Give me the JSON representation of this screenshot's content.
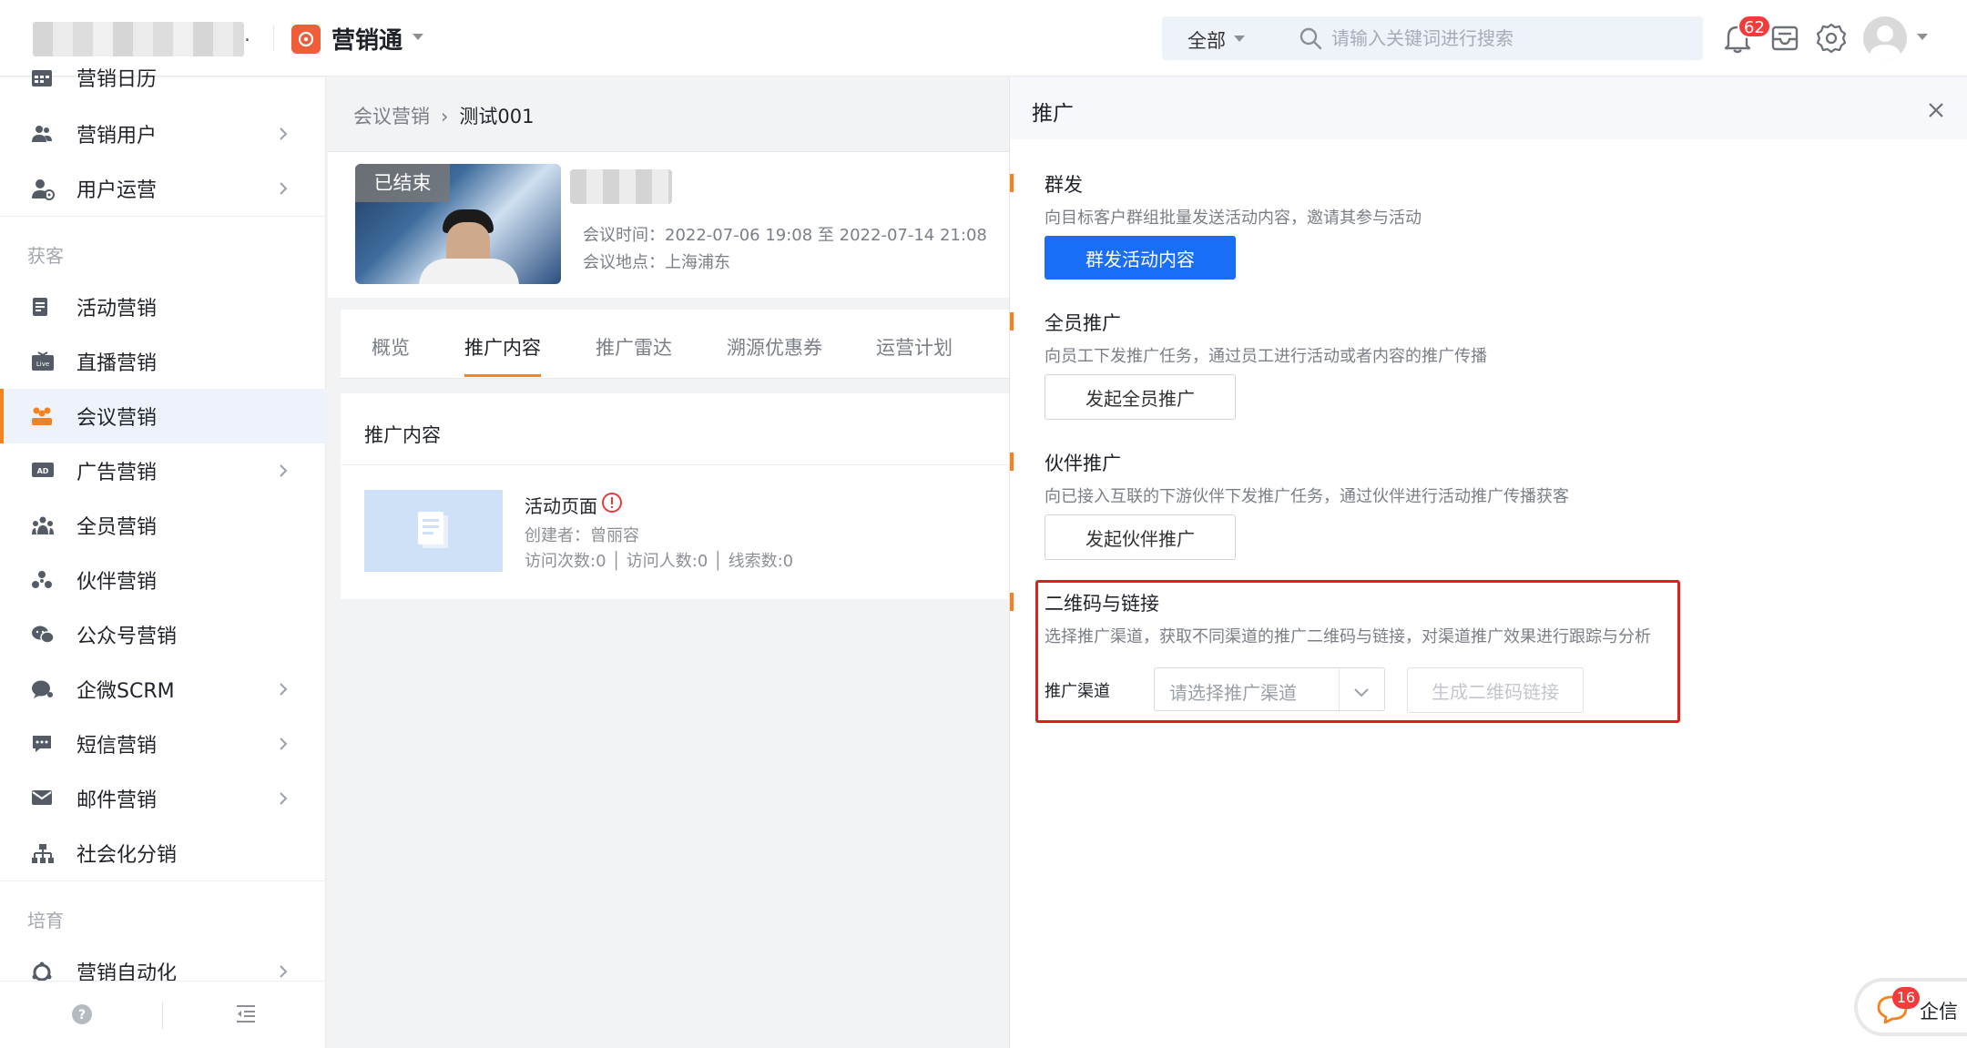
{
  "topbar": {
    "brand_title": "营销通",
    "org_suffix": ".",
    "search": {
      "scope": "全部",
      "placeholder": "请输入关键词进行搜索"
    },
    "notification_count": "62"
  },
  "sidebar": {
    "items_top": [
      {
        "label": "营销日历",
        "icon": "calendar-icon"
      },
      {
        "label": "营销用户",
        "icon": "users-icon",
        "has_children": true
      },
      {
        "label": "用户运营",
        "icon": "user-ops-icon",
        "has_children": true
      }
    ],
    "group_acquire": "获客",
    "items_acquire": [
      {
        "label": "活动营销",
        "icon": "activity-icon"
      },
      {
        "label": "直播营销",
        "icon": "live-icon"
      },
      {
        "label": "会议营销",
        "icon": "meeting-icon",
        "active": true
      },
      {
        "label": "广告营销",
        "icon": "ad-icon",
        "has_children": true
      },
      {
        "label": "全员营销",
        "icon": "team-icon"
      },
      {
        "label": "伙伴营销",
        "icon": "partner-icon"
      },
      {
        "label": "公众号营销",
        "icon": "wechat-icon"
      },
      {
        "label": "企微SCRM",
        "icon": "scrm-icon",
        "has_children": true
      },
      {
        "label": "短信营销",
        "icon": "sms-icon",
        "has_children": true
      },
      {
        "label": "邮件营销",
        "icon": "mail-icon",
        "has_children": true
      },
      {
        "label": "社会化分销",
        "icon": "distribution-icon"
      }
    ],
    "group_nurture": "培育",
    "items_nurture": [
      {
        "label": "营销自动化",
        "icon": "automation-icon",
        "has_children": true
      }
    ]
  },
  "main": {
    "breadcrumb": {
      "parent": "会议营销",
      "current": "测试001"
    },
    "meeting": {
      "status_tag": "已结束",
      "time": "会议时间：2022-07-06 19:08 至 2022-07-14 21:08",
      "location": "会议地点：上海浦东"
    },
    "tabs": [
      "概览",
      "推广内容",
      "推广雷达",
      "溯源优惠券",
      "运营计划"
    ],
    "active_tab": 1,
    "content": {
      "title": "推广内容",
      "item": {
        "title": "活动页面",
        "creator": "创建者：曾丽容",
        "stats": "访问次数:0 │ 访问人数:0 │ 线索数:0"
      }
    }
  },
  "drawer": {
    "title": "推广",
    "sections": [
      {
        "title": "群发",
        "desc": "向目标客户群组批量发送活动内容，邀请其参与活动",
        "button": "群发活动内容"
      },
      {
        "title": "全员推广",
        "desc": "向员工下发推广任务，通过员工进行活动或者内容的推广传播",
        "button": "发起全员推广"
      },
      {
        "title": "伙伴推广",
        "desc": "向已接入互联的下游伙伴下发推广任务，通过伙伴进行活动推广传播获客",
        "button": "发起伙伴推广"
      },
      {
        "title": "二维码与链接",
        "desc": "选择推广渠道，获取不同渠道的推广二维码与链接，对渠道推广效果进行跟踪与分析"
      }
    ],
    "channel_label": "推广渠道",
    "channel_placeholder": "请选择推广渠道",
    "generate_button": "生成二维码链接"
  },
  "chat": {
    "badge": "16",
    "label": "企信"
  },
  "colors": {
    "accent": "#f5821f",
    "primary": "#1a6df5",
    "highlight": "#e11d1d",
    "badge": "#f23c3c"
  }
}
